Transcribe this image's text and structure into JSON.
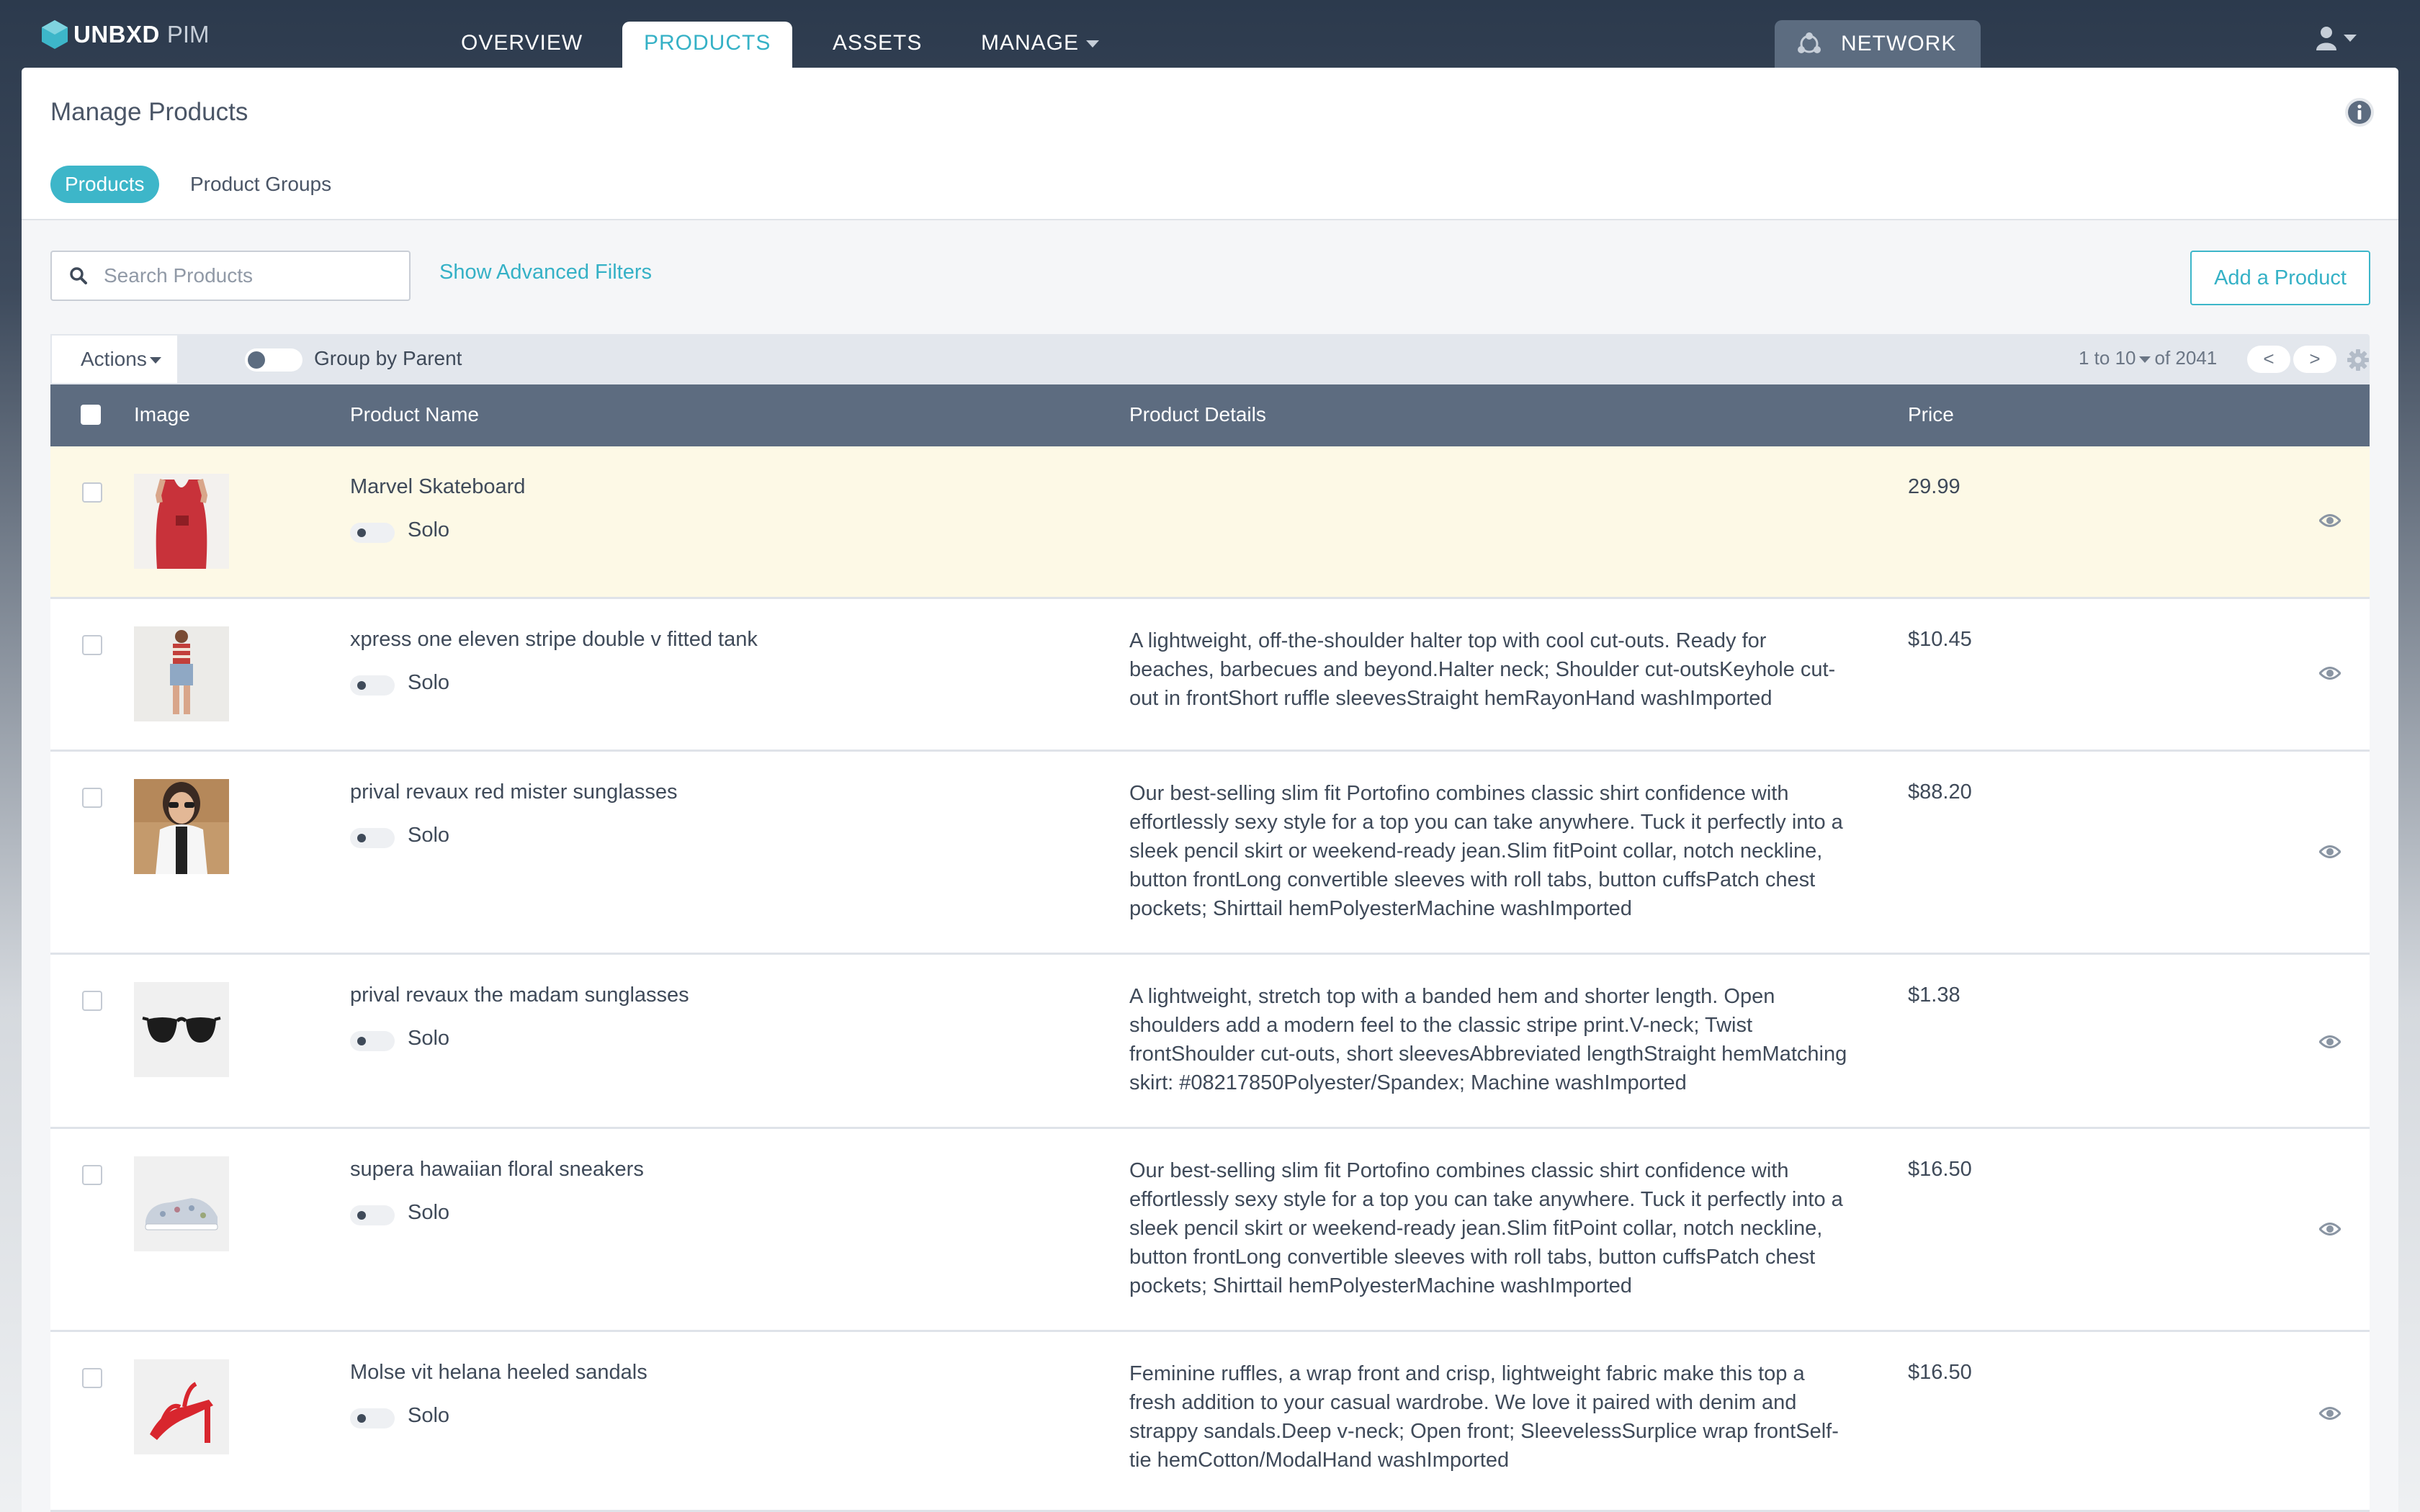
{
  "brand": {
    "name": "UNBXD",
    "product": "PIM"
  },
  "nav": {
    "tabs": [
      {
        "label": "OVERVIEW",
        "active": false
      },
      {
        "label": "PRODUCTS",
        "active": true
      },
      {
        "label": "ASSETS",
        "active": false
      },
      {
        "label": "MANAGE",
        "active": false,
        "has_dropdown": true
      }
    ],
    "network_label": "NETWORK",
    "user_icon": "user-icon"
  },
  "page": {
    "title": "Manage Products",
    "subtabs": [
      {
        "label": "Products",
        "active": true
      },
      {
        "label": "Product Groups",
        "active": false
      }
    ]
  },
  "search": {
    "placeholder": "Search Products",
    "value": ""
  },
  "filters": {
    "advanced_label": "Show Advanced Filters"
  },
  "add_product_label": "Add a Product",
  "toolbar": {
    "actions_label": "Actions",
    "group_by_parent_label": "Group by Parent",
    "group_by_parent_on": false,
    "page_size": "1 to 10",
    "total": "of 2041",
    "prev_label": "<",
    "next_label": ">"
  },
  "table": {
    "columns": [
      "Image",
      "Product Name",
      "Product Details",
      "Price"
    ],
    "rows": [
      {
        "name": "Marvel Skateboard",
        "type": "Solo",
        "details": "",
        "price": "29.99",
        "image": "red-tank-top"
      },
      {
        "name": "xpress one eleven stripe double v fitted tank",
        "type": "Solo",
        "details": "A lightweight, off-the-shoulder halter top with cool cut-outs. Ready for beaches, barbecues and beyond.Halter neck; Shoulder cut-outsKeyhole cut-out in frontShort ruffle sleevesStraight hemRayonHand washImported",
        "price": "$10.45",
        "image": "model-denim-shorts"
      },
      {
        "name": "prival revaux red mister sunglasses",
        "type": "Solo",
        "details": "Our best-selling slim fit Portofino combines classic shirt confidence with effortlessly sexy style for a top you can take anywhere. Tuck it perfectly into a sleek pencil skirt or weekend-ready jean.Slim fitPoint collar, notch neckline, button frontLong convertible sleeves with roll tabs, button cuffsPatch chest pockets; Shirttail hemPolyesterMachine washImported",
        "price": "$88.20",
        "image": "model-sunglasses"
      },
      {
        "name": "prival revaux the madam sunglasses",
        "type": "Solo",
        "details": "A lightweight, stretch top with a banded hem and shorter length. Open shoulders add a modern feel to the classic stripe print.V-neck; Twist frontShoulder cut-outs, short sleevesAbbreviated lengthStraight hemMatching skirt: #08217850Polyester/Spandex; Machine washImported",
        "price": "$1.38",
        "image": "black-sunglasses"
      },
      {
        "name": "supera hawaiian floral sneakers",
        "type": "Solo",
        "details": "Our best-selling slim fit Portofino combines classic shirt confidence with effortlessly sexy style for a top you can take anywhere. Tuck it perfectly into a sleek pencil skirt or weekend-ready jean.Slim fitPoint collar, notch neckline, button frontLong convertible sleeves with roll tabs, button cuffsPatch chest pockets; Shirttail hemPolyesterMachine washImported",
        "price": "$16.50",
        "image": "floral-sneaker"
      },
      {
        "name": "Molse vit helana heeled sandals",
        "type": "Solo",
        "details": "Feminine ruffles, a wrap front and crisp, lightweight fabric make this top a fresh addition to your casual wardrobe. We love it paired with denim and strappy sandals.Deep v-neck; Open front; SleevelessSurplice wrap frontSelf-tie hemCotton/ModalHand washImported",
        "price": "$16.50",
        "image": "red-heeled-sandal"
      }
    ]
  },
  "colors": {
    "nav_bg": "#2c3a4d",
    "accent": "#35b1c6",
    "table_header": "#5d6c80",
    "highlight_row": "#fdf9e6"
  }
}
